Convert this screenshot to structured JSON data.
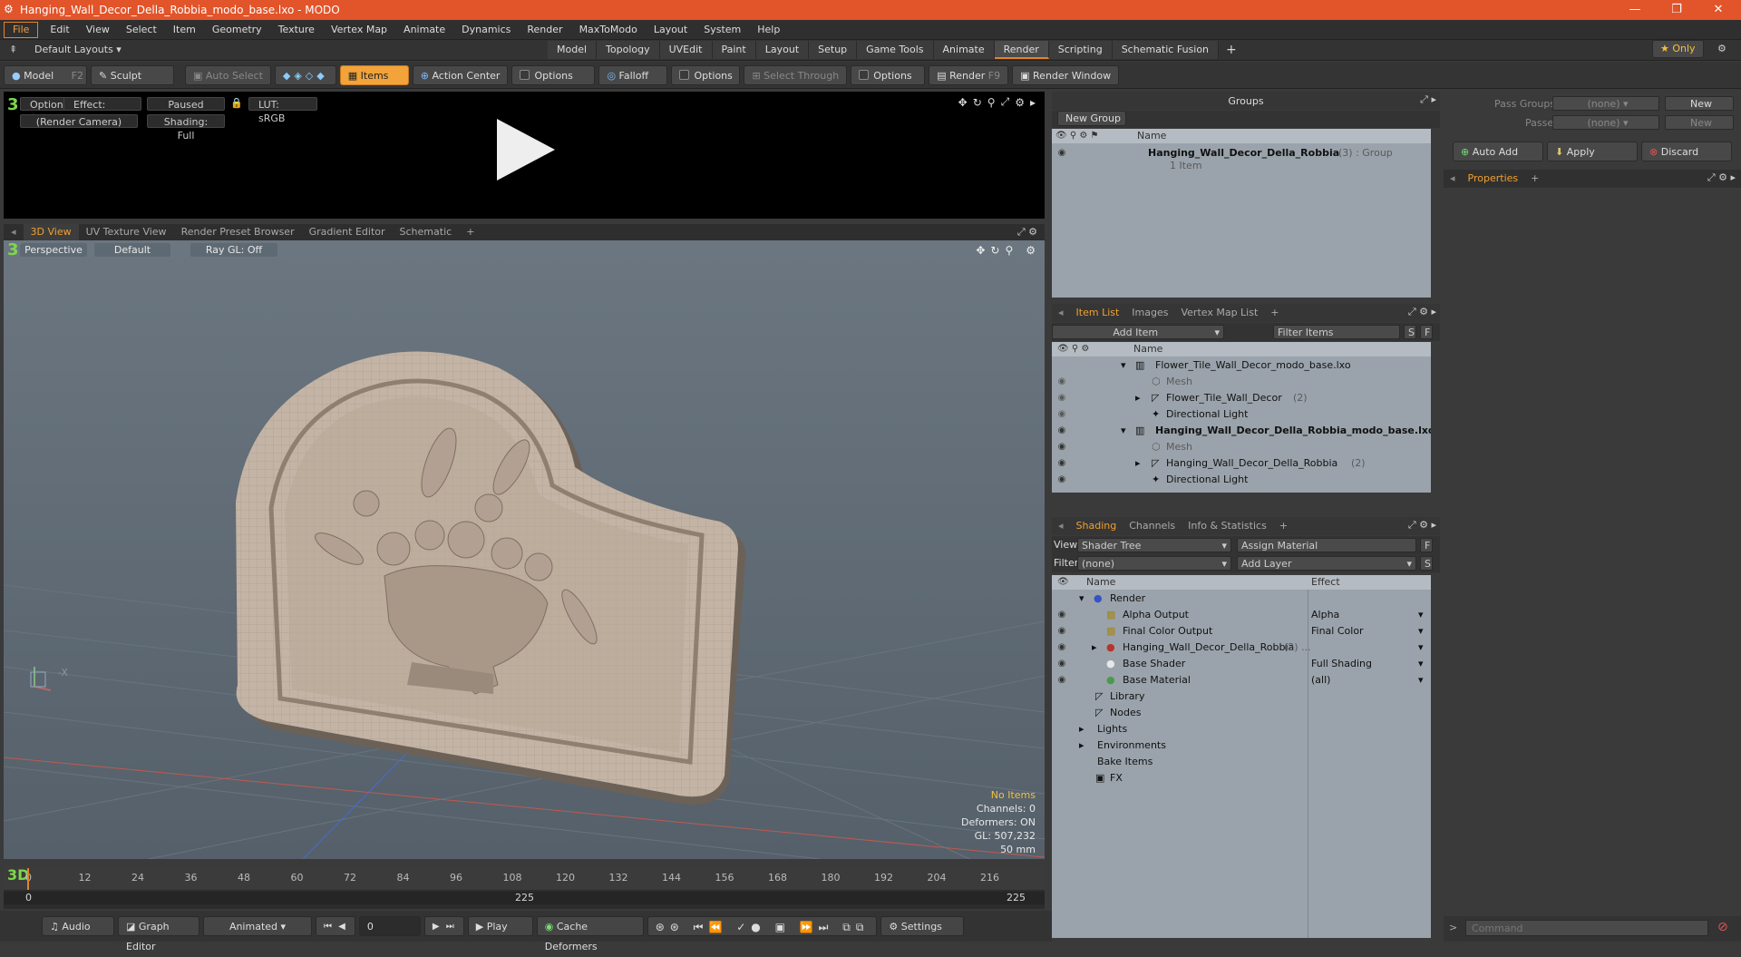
{
  "window": {
    "title": "Hanging_Wall_Decor_Della_Robbia_modo_base.lxo - MODO",
    "minimize": "—",
    "restore": "❐",
    "close": "✕"
  },
  "menu": [
    "File",
    "Edit",
    "View",
    "Select",
    "Item",
    "Geometry",
    "Texture",
    "Vertex Map",
    "Animate",
    "Dynamics",
    "Render",
    "MaxToModo",
    "Layout",
    "System",
    "Help"
  ],
  "layouts": {
    "default": "Default Layouts ▾",
    "tabs": [
      "Model",
      "Topology",
      "UVEdit",
      "Paint",
      "Layout",
      "Setup",
      "Game Tools",
      "Animate",
      "Render",
      "Scripting",
      "Schematic Fusion"
    ],
    "active": "Render",
    "add": "+",
    "only": "★  Only"
  },
  "toolbar": {
    "model": "Model",
    "model_key": "F2",
    "sculpt": "Sculpt",
    "auto_select": "Auto Select",
    "items": "Items",
    "action_center": "Action Center",
    "options1": "Options",
    "falloff": "Falloff",
    "options2": "Options",
    "select_through": "Select Through",
    "options3": "Options",
    "render": "Render",
    "render_key": "F9",
    "render_window": "Render Window"
  },
  "preview": {
    "options": "Options",
    "effect": "Effect: (Shadi...",
    "paused": "Paused",
    "lut": "LUT: sRGB",
    "camera": "(Render Camera)",
    "shading": "Shading: Full"
  },
  "viewtabs": [
    "3D View",
    "UV Texture View",
    "Render Preset Browser",
    "Gradient Editor",
    "Schematic",
    "+"
  ],
  "viewport": {
    "perspective": "Perspective",
    "default": "Default",
    "raygl": "Ray GL: Off",
    "neg_x": "-X",
    "info": [
      "No Items",
      "Channels: 0",
      "Deformers: ON",
      "GL: 507,232",
      "50 mm"
    ]
  },
  "timeline": {
    "ticks": [
      "0",
      "12",
      "24",
      "36",
      "48",
      "60",
      "72",
      "84",
      "96",
      "108",
      "120",
      "132",
      "144",
      "156",
      "168",
      "180",
      "192",
      "204",
      "216"
    ],
    "start": "0",
    "mid": "225",
    "end": "225"
  },
  "transport": {
    "audio": "Audio",
    "graph": "Graph Editor",
    "animated": "Animated",
    "frame": "0",
    "play": "Play",
    "cache": "Cache Deformers",
    "settings": "Settings"
  },
  "groups": {
    "title": "Groups",
    "new_group": "New Group",
    "col_name": "Name",
    "item": "Hanging_Wall_Decor_Della_Robbia",
    "item_meta": "(3) : Group",
    "item_sub": "1 Item"
  },
  "itemlist": {
    "tabs": [
      "Item List",
      "Images",
      "Vertex Map List",
      "+"
    ],
    "add_item": "Add Item",
    "filter": "Filter Items",
    "col_name": "Name",
    "rows": [
      {
        "label": "Flower_Tile_Wall_Decor_modo_base.lxo",
        "bold": false
      },
      {
        "label": "Mesh",
        "bold": false
      },
      {
        "label": "Flower_Tile_Wall_Decor",
        "meta": "(2)",
        "bold": false
      },
      {
        "label": "Directional Light",
        "bold": false
      },
      {
        "label": "Hanging_Wall_Decor_Della_Robbia_modo_base.lxo",
        "bold": true
      },
      {
        "label": "Mesh",
        "bold": false
      },
      {
        "label": "Hanging_Wall_Decor_Della_Robbia",
        "meta": "(2)",
        "bold": false
      },
      {
        "label": "Directional Light",
        "bold": false
      }
    ]
  },
  "shading": {
    "tabs": [
      "Shading",
      "Channels",
      "Info & Statistics",
      "+"
    ],
    "view_label": "View",
    "view": "Shader Tree",
    "assign": "Assign Material",
    "filter_label": "Filter",
    "filter": "(none)",
    "add_layer": "Add Layer",
    "col_name": "Name",
    "col_effect": "Effect",
    "rows": [
      {
        "name": "Render",
        "effect": ""
      },
      {
        "name": "Alpha Output",
        "effect": "Alpha"
      },
      {
        "name": "Final Color Output",
        "effect": "Final Color"
      },
      {
        "name": "Hanging_Wall_Decor_Della_Robbia",
        "meta": "(2) ...",
        "effect": ""
      },
      {
        "name": "Base Shader",
        "effect": "Full Shading"
      },
      {
        "name": "Base Material",
        "effect": "(all)"
      },
      {
        "name": "Library",
        "effect": ""
      },
      {
        "name": "Nodes",
        "effect": ""
      },
      {
        "name": "Lights",
        "effect": ""
      },
      {
        "name": "Environments",
        "effect": ""
      },
      {
        "name": "Bake Items",
        "effect": ""
      },
      {
        "name": "FX",
        "effect": ""
      }
    ]
  },
  "passes": {
    "pass_groups": "Pass Groups",
    "passes": "Passes",
    "none": "(none)",
    "new": "New",
    "auto_add": "Auto Add",
    "apply": "Apply",
    "discard": "Discard"
  },
  "properties": {
    "tab": "Properties",
    "add": "+"
  },
  "command": {
    "placeholder": "Command"
  }
}
